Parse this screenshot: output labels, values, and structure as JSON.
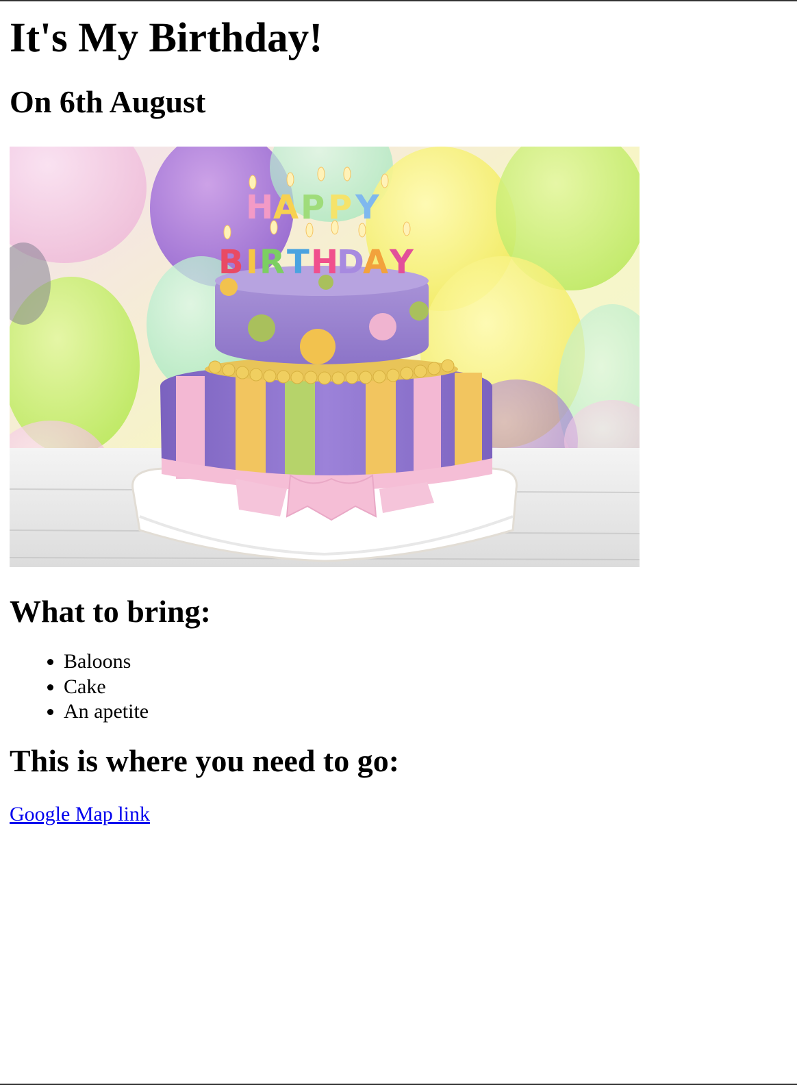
{
  "page": {
    "title": "It's My Birthday!",
    "date": "On 6th August",
    "image": {
      "description": "cake-photo",
      "cake_text_line1": "HAPPY",
      "cake_text_line2": "BIRTHDAY"
    },
    "bring_heading": "What to bring:",
    "bring_items": [
      "Baloons",
      "Cake",
      "An apetite"
    ],
    "go_heading": "This is where you need to go:",
    "map_link_label": "Google Map link"
  },
  "colors": {
    "link": "#0000ee",
    "text": "#000000",
    "background": "#ffffff"
  }
}
